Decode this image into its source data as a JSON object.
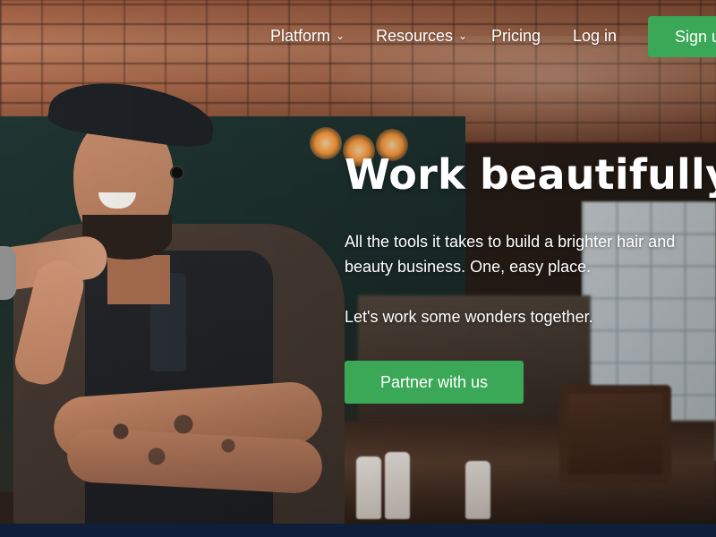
{
  "nav": {
    "items": [
      {
        "label": "Platform",
        "has_dropdown": true
      },
      {
        "label": "Resources",
        "has_dropdown": true
      },
      {
        "label": "Pricing",
        "has_dropdown": false
      },
      {
        "label": "Log in",
        "has_dropdown": false
      }
    ],
    "cta_label": "Sign up",
    "dropdown_icon": "chevron-down-icon"
  },
  "hero": {
    "title": "Work beautifully",
    "line1": "All the tools it takes to build a brighter hair and",
    "line2": "beauty business. One, easy place.",
    "line3": "Let's work some wonders together.",
    "button_label": "Partner with us"
  },
  "colors": {
    "accent_green": "#3aa856",
    "text": "#ffffff",
    "footer_navy": "#0f1f3a"
  }
}
